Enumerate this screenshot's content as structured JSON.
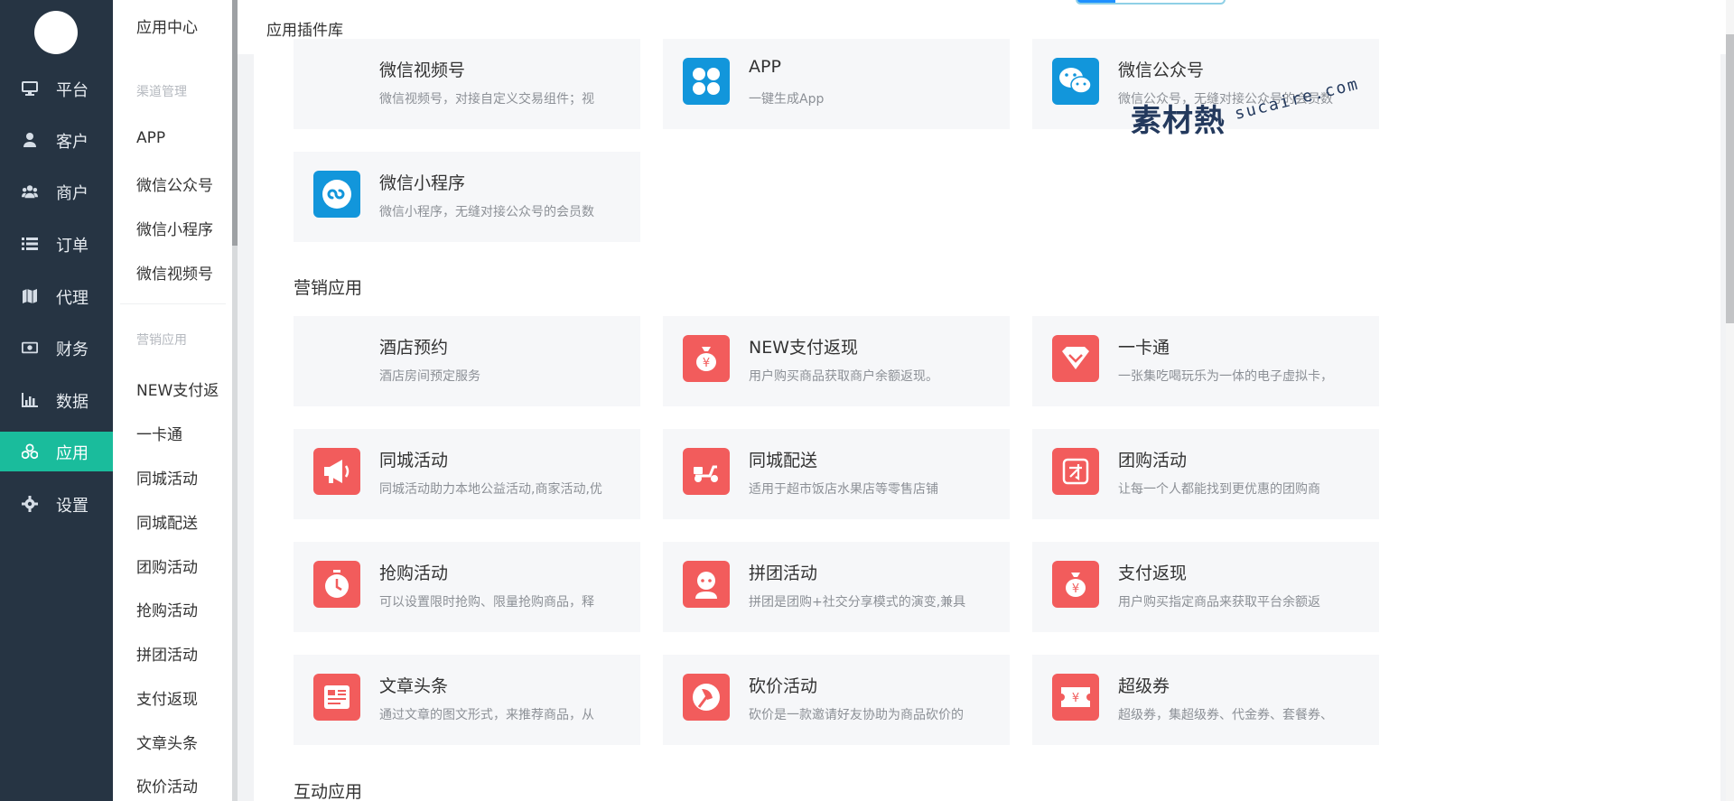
{
  "nav": {
    "items": [
      {
        "label": "平台",
        "icon": "monitor-icon"
      },
      {
        "label": "客户",
        "icon": "user-icon"
      },
      {
        "label": "商户",
        "icon": "users-icon"
      },
      {
        "label": "订单",
        "icon": "list-icon"
      },
      {
        "label": "代理",
        "icon": "map-icon"
      },
      {
        "label": "财务",
        "icon": "money-icon"
      },
      {
        "label": "数据",
        "icon": "bar-chart-icon"
      },
      {
        "label": "应用",
        "icon": "cubes-icon",
        "active": true
      },
      {
        "label": "设置",
        "icon": "gear-icon"
      }
    ],
    "active_color": "#1abc9c",
    "bg_color": "#263443"
  },
  "submenu": {
    "title": "应用中心",
    "groups": [
      {
        "title": "渠道管理",
        "items": [
          "APP",
          "微信公众号",
          "微信小程序",
          "微信视频号"
        ]
      },
      {
        "title": "营销应用",
        "items": [
          "NEW支付返",
          "一卡通",
          "同城活动",
          "同城配送",
          "团购活动",
          "抢购活动",
          "拼团活动",
          "支付返现",
          "文章头条",
          "砍价活动"
        ]
      }
    ]
  },
  "header": {
    "title": "应用插件库"
  },
  "sections": {
    "marketing": "营销应用",
    "interactive": "互动应用"
  },
  "channel_cards": [
    {
      "title": "微信视频号",
      "desc": "微信视频号，对接自定义交易组件；视",
      "icon": "none"
    },
    {
      "title": "APP",
      "desc": "一键生成App",
      "icon": "app-grid-icon"
    },
    {
      "title": "微信公众号",
      "desc": "微信公众号，无缝对接公众号的会员数",
      "icon": "wechat-icon"
    },
    {
      "title": "微信小程序",
      "desc": "微信小程序，无缝对接公众号的会员数",
      "icon": "mini-program-icon"
    }
  ],
  "marketing_cards": [
    {
      "title": "酒店预约",
      "desc": "酒店房间预定服务",
      "icon": "none"
    },
    {
      "title": "NEW支付返现",
      "desc": "用户购买商品获取商户余额返现。",
      "icon": "money-bag-icon"
    },
    {
      "title": "一卡通",
      "desc": "一张集吃喝玩乐为一体的电子虚拟卡，",
      "icon": "diamond-icon"
    },
    {
      "title": "同城活动",
      "desc": "同城活动助力本地公益活动,商家活动,优",
      "icon": "megaphone-icon"
    },
    {
      "title": "同城配送",
      "desc": "适用于超市饭店水果店等零售店铺",
      "icon": "scooter-icon"
    },
    {
      "title": "团购活动",
      "desc": "让每一个人都能找到更优惠的团购商",
      "icon": "group-buy-icon"
    },
    {
      "title": "抢购活动",
      "desc": "可以设置限时抢购、限量抢购商品，释",
      "icon": "stopwatch-icon"
    },
    {
      "title": "拼团活动",
      "desc": "拼团是团购+社交分享模式的演变,兼具",
      "icon": "person-icon"
    },
    {
      "title": "支付返现",
      "desc": "用户购买指定商品来获取平台余额返",
      "icon": "money-bag-icon"
    },
    {
      "title": "文章头条",
      "desc": "通过文章的图文形式，来推荐商品，从",
      "icon": "article-icon"
    },
    {
      "title": "砍价活动",
      "desc": "砍价是一款邀请好友协助为商品砍价的",
      "icon": "axe-icon"
    },
    {
      "title": "超级券",
      "desc": "超级券，集超级券、代金券、套餐券、",
      "icon": "ticket-icon"
    }
  ],
  "watermark": {
    "logo": "素材熱",
    "domain": "sucaire.com"
  },
  "colors": {
    "red_icon": "#f25c5c",
    "blue_icon": "#1296db",
    "card_bg": "#f6f7f9"
  }
}
